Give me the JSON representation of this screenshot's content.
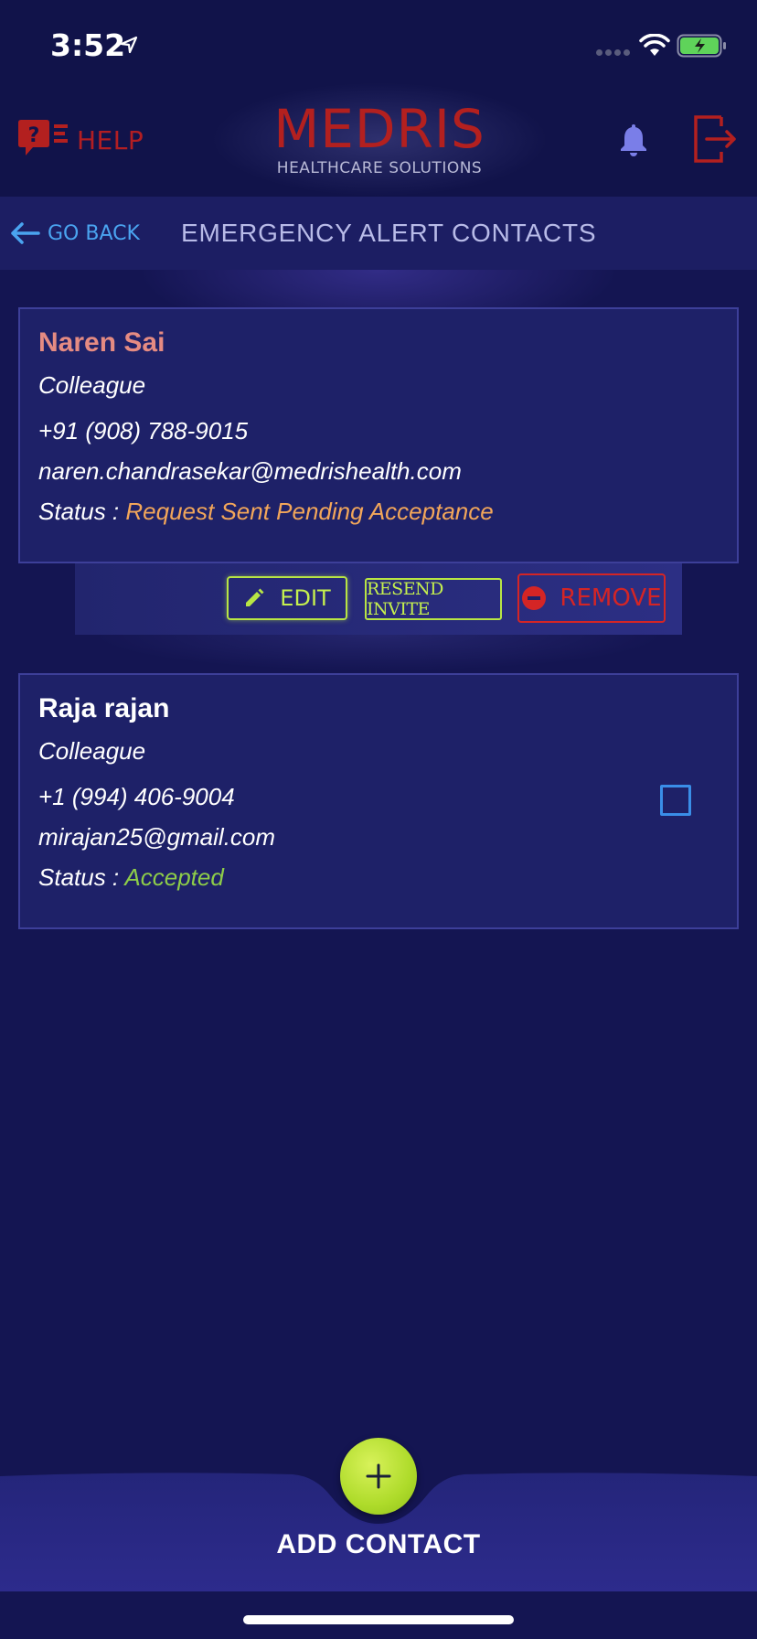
{
  "status_bar": {
    "time": "3:52",
    "icons": [
      "location-arrow-icon",
      "signal-icon",
      "wifi-icon",
      "battery-charging-icon"
    ]
  },
  "header": {
    "help_label": "HELP",
    "logo_title": "MEDRIS",
    "logo_subtitle": "HEALTHCARE SOLUTIONS",
    "icons": [
      "help-chat-icon",
      "bell-icon",
      "logout-icon"
    ]
  },
  "nav": {
    "back_label": "GO BACK",
    "title": "EMERGENCY ALERT CONTACTS"
  },
  "contacts": [
    {
      "name": "Naren Sai",
      "relation": "Colleague",
      "phone": "+91 (908) 788-9015",
      "email": "naren.chandrasekar@medrishealth.com",
      "status_prefix": "Status : ",
      "status": "Request Sent Pending Acceptance"
    },
    {
      "name": "Raja rajan",
      "relation": "Colleague",
      "phone": "+1 (994) 406-9004",
      "email": "mirajan25@gmail.com",
      "status_prefix": "Status : ",
      "status": "Accepted",
      "checked": false
    }
  ],
  "actions": {
    "edit_label": "EDIT",
    "resend_label": "RESEND INVITE",
    "remove_label": "REMOVE"
  },
  "footer": {
    "add_label": "ADD CONTACT"
  },
  "colors": {
    "background": "#141552",
    "brand_red": "#b3201f",
    "accent_green": "#c5f04e",
    "pending": "#f2a65a",
    "accepted": "#8dcc49",
    "link_blue": "#4aa4f0"
  }
}
